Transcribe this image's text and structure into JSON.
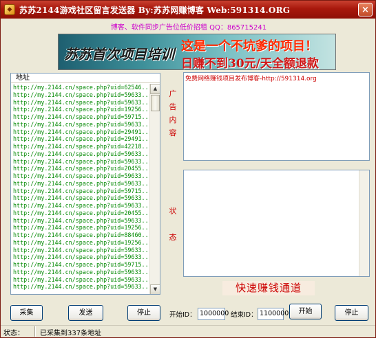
{
  "window": {
    "title": "苏苏2144游戏社区留言发送器  By:苏苏网赚博客  Web:591314.ORG",
    "close_label": "×",
    "accent_color": "#a8180c"
  },
  "info_line": "博客、软件同步广告位低价招租  QQ：865715241",
  "banner": {
    "left_text": "苏苏首次项目培训",
    "right_line1": "这是一个不坑爹的项目！",
    "right_line2": "日赚不到30元/天全额退款"
  },
  "address_list": {
    "header": "地址",
    "items": [
      "http://my.2144.cn/space.php?uid=62546...",
      "http://my.2144.cn/space.php?uid=59633...",
      "http://my.2144.cn/space.php?uid=59633...",
      "http://my.2144.cn/space.php?uid=19256...",
      "http://my.2144.cn/space.php?uid=59715...",
      "http://my.2144.cn/space.php?uid=59633...",
      "http://my.2144.cn/space.php?uid=29491...",
      "http://my.2144.cn/space.php?uid=29491...",
      "http://my.2144.cn/space.php?uid=42218...",
      "http://my.2144.cn/space.php?uid=59633...",
      "http://my.2144.cn/space.php?uid=59633...",
      "http://my.2144.cn/space.php?uid=20455...",
      "http://my.2144.cn/space.php?uid=59633...",
      "http://my.2144.cn/space.php?uid=59633...",
      "http://my.2144.cn/space.php?uid=59715...",
      "http://my.2144.cn/space.php?uid=59633...",
      "http://my.2144.cn/space.php?uid=59633...",
      "http://my.2144.cn/space.php?uid=20455...",
      "http://my.2144.cn/space.php?uid=59633...",
      "http://my.2144.cn/space.php?uid=19256...",
      "http://my.2144.cn/space.php?uid=88460...",
      "http://my.2144.cn/space.php?uid=19256...",
      "http://my.2144.cn/space.php?uid=59633...",
      "http://my.2144.cn/space.php?uid=59633...",
      "http://my.2144.cn/space.php?uid=59715...",
      "http://my.2144.cn/space.php?uid=59633...",
      "http://my.2144.cn/space.php?uid=59633...",
      "http://my.2144.cn/space.php?uid=59633..."
    ],
    "scroll_up": "▲",
    "scroll_down": "▼"
  },
  "labels": {
    "ad_vertical": [
      "广",
      "告",
      "内",
      "容"
    ],
    "status_vertical": [
      "状",
      "态"
    ]
  },
  "ad_content": "免费网络赚钱项目发布博客-http://591314.org",
  "fast_channel": "快速赚钱通道",
  "buttons": {
    "collect": "采集",
    "send": "发送",
    "stop_left": "停止",
    "start": "开始",
    "stop_right": "停止"
  },
  "start_id": {
    "label": "开始ID：",
    "value": "1000000"
  },
  "end_id": {
    "label": "结束ID：",
    "value": "1100000"
  },
  "statusbar": {
    "label": "状态：",
    "text": "已采集到337条地址"
  }
}
